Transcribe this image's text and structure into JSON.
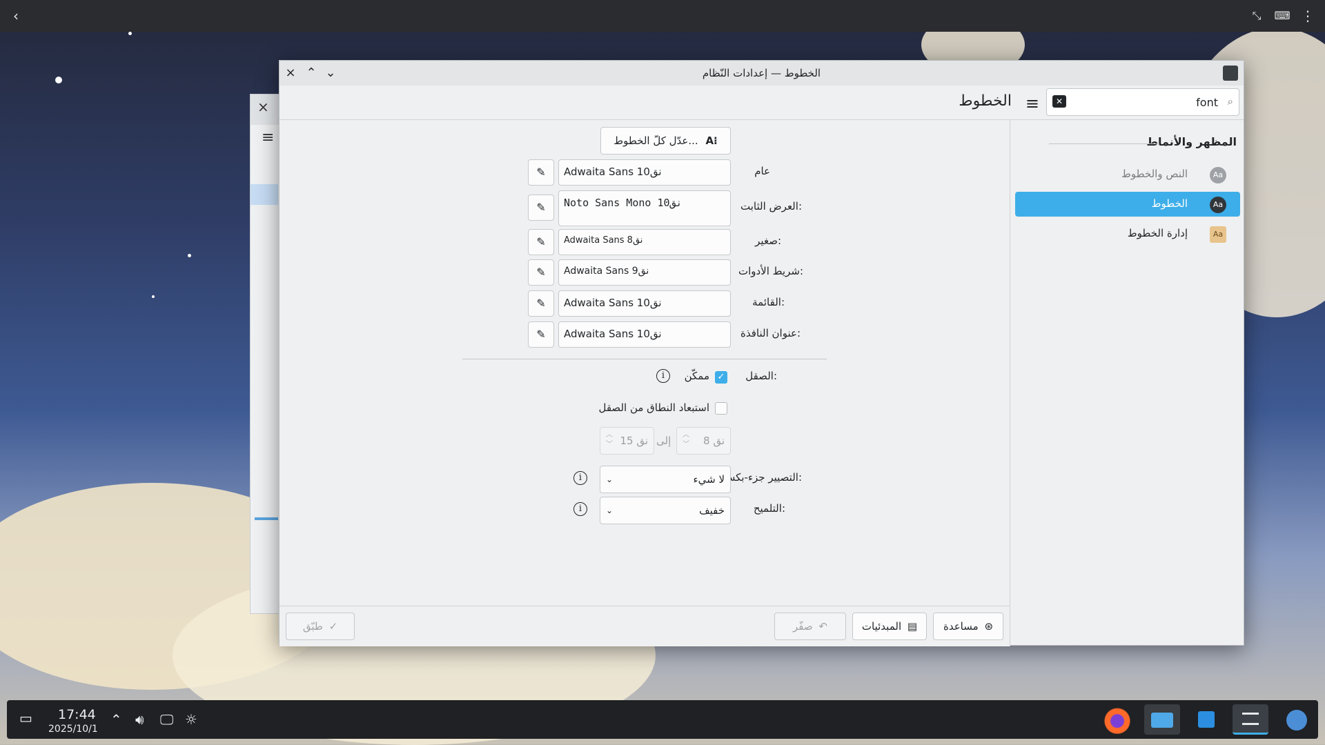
{
  "window": {
    "title": "الخطوط — إعدادات النّظام",
    "page_title": "الخطوط",
    "search_value": "font"
  },
  "sidebar": {
    "heading": "المظهر والأنماط",
    "items": [
      {
        "label": "النص والخطوط",
        "icon": "Aa"
      },
      {
        "label": "الخطوط",
        "icon": "Aa"
      },
      {
        "label": "إدارة الخطوط",
        "icon": "Aa"
      }
    ]
  },
  "form": {
    "adjust_all": "عدّل كلّ الخطوط...",
    "adjust_all_icon": "A⁝",
    "rows": [
      {
        "label": "عام",
        "value": "Adwaita Sans 10نق"
      },
      {
        "label": "العرض الثابت:",
        "value": "Noto Sans Mono 10نق"
      },
      {
        "label": "صغير:",
        "value": "Adwaita Sans 8نق"
      },
      {
        "label": "شريط الأدوات:",
        "value": "Adwaita Sans 9نق"
      },
      {
        "label": "القائمة:",
        "value": "Adwaita Sans 10نق"
      },
      {
        "label": "عنوان النافذة:",
        "value": "Adwaita Sans 10نق"
      }
    ],
    "antialias_label": "الصقل:",
    "antialias_check": "ممكّن",
    "antialias_enabled": true,
    "exclude_label": "استبعاد النطاق من الصقل",
    "exclude_enabled": false,
    "range_from": "8 نق",
    "range_to_word": "إلى",
    "range_to": "15 نق",
    "subpixel_label": "التصيير جزء-بكسلي:",
    "subpixel_value": "لا شيء",
    "hinting_label": "التلميح:",
    "hinting_value": "خفيف"
  },
  "buttons": {
    "help": "مساعدة",
    "defaults": "المبدئيات",
    "reset": "صفّر",
    "apply": "طبّق"
  },
  "taskbar": {
    "time": "17:44",
    "date": "2025/10/1"
  },
  "colors": {
    "accent": "#3daee9",
    "panel": "#1f2124"
  }
}
